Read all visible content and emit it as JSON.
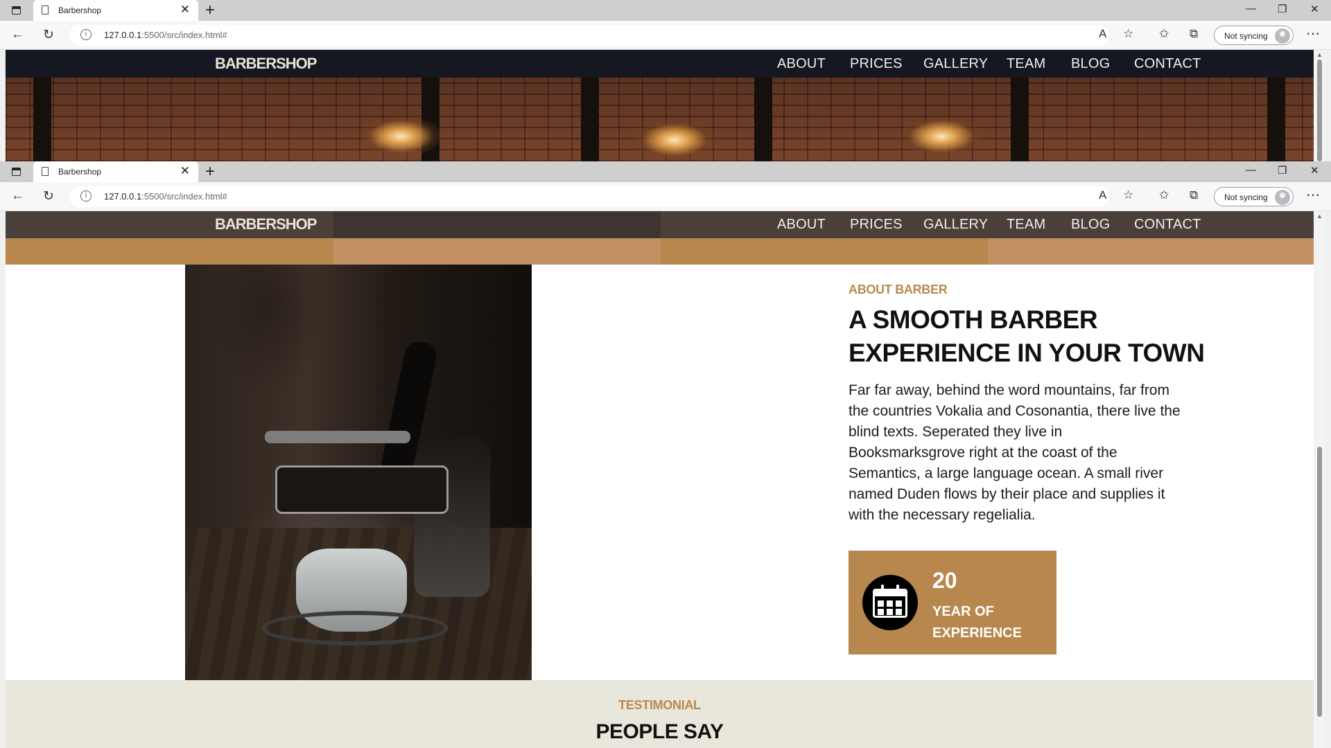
{
  "browser": {
    "tab_title": "Barbershop",
    "url_host": "127.0.0.1",
    "url_rest": ":5500/src/index.html#",
    "sync_label": "Not syncing"
  },
  "site": {
    "logo": "BARBERSHOP",
    "menu": [
      "ABOUT",
      "PRICES",
      "GALLERY",
      "TEAM",
      "BLOG",
      "CONTACT"
    ]
  },
  "about": {
    "kicker": "ABOUT BARBER",
    "heading_line1": "A SMOOTH BARBER",
    "heading_line2": "EXPERIENCE IN YOUR TOWN",
    "paragraph": "Far far away, behind the word mountains, far from the countries Vokalia and Cosonantia, there live the blind texts. Seperated they live in Booksmarksgrove right at the coast of the Semantics, a large language ocean. A small river named Duden flows by their place and supplies it with the necessary regelialia.",
    "experience_number": "20",
    "experience_label": "YEAR OF EXPERIENCE"
  },
  "testimonial": {
    "kicker": "TESTIMONIAL",
    "title": "PEOPLE SAY"
  },
  "colors": {
    "accent": "#b8874d",
    "nav_dark": "#4a3f39",
    "testimonial_bg": "#e9e6dc"
  },
  "icons": [
    "sidebar-icon",
    "page-icon",
    "close-icon",
    "plus-icon",
    "back-icon",
    "reload-icon",
    "info-icon",
    "read-aloud-icon",
    "favorite-add-icon",
    "favorites-icon",
    "collections-icon",
    "avatar-icon",
    "more-icon",
    "calendar-icon"
  ]
}
